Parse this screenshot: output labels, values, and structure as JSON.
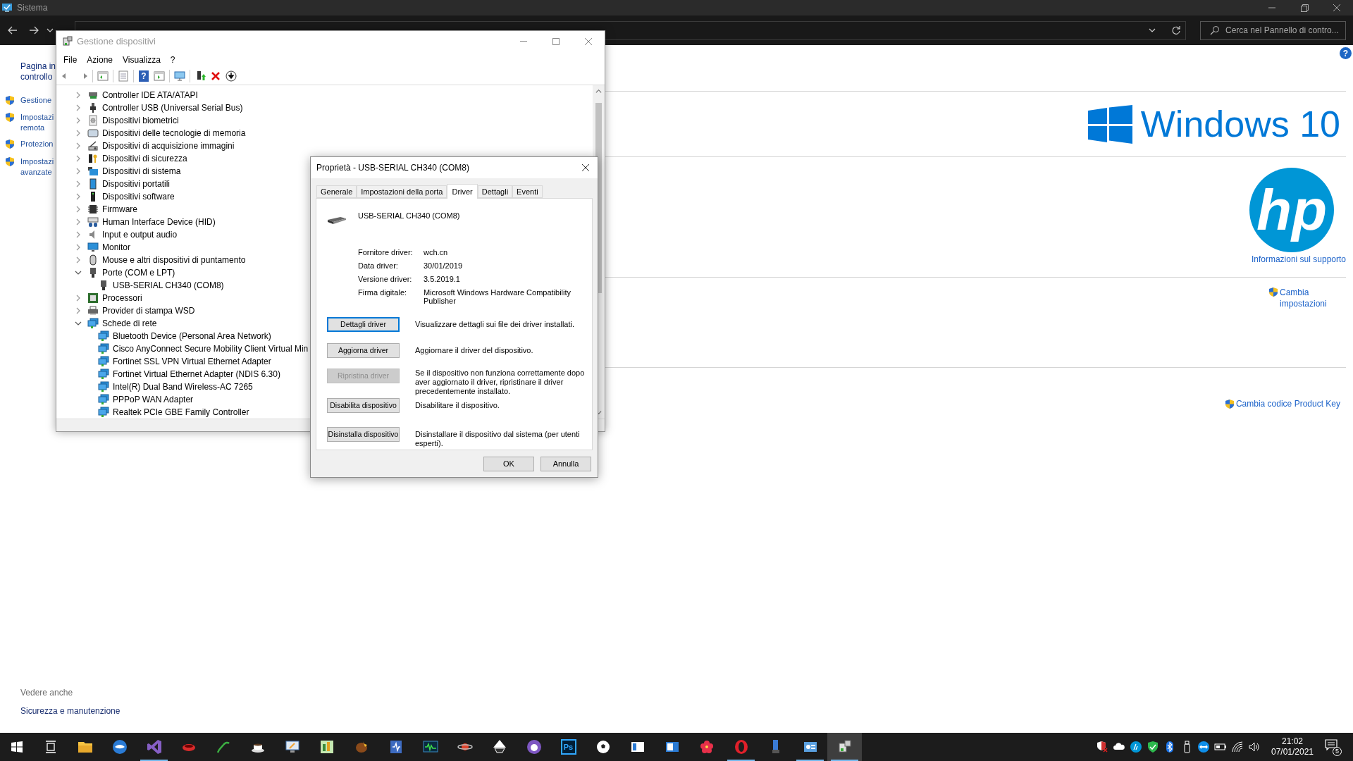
{
  "window": {
    "title": "Sistema",
    "search": {
      "placeholder": "Cerca nel Pannello di contro..."
    },
    "help": "?"
  },
  "sidebar": {
    "items": [
      {
        "kind": "home",
        "lines": [
          "Pagina in",
          "controllo"
        ]
      },
      {
        "kind": "admin",
        "lines": [
          "Gestione"
        ]
      },
      {
        "kind": "admin",
        "lines": [
          "Impostazi",
          "remota"
        ]
      },
      {
        "kind": "admin",
        "lines": [
          "Protezion"
        ]
      },
      {
        "kind": "admin",
        "lines": [
          "Impostazi",
          "avanzate"
        ]
      }
    ],
    "see_also": {
      "heading": "Vedere anche",
      "links": [
        "Sicurezza e manutenzione"
      ]
    }
  },
  "windows_logo": {
    "text": "Windows 10"
  },
  "manufacturer": {
    "logo": "hp",
    "support_link": "Informazioni sul supporto"
  },
  "settings_link": "Cambia impostazioni",
  "product_key_link": "Cambia codice Product Key",
  "device_manager": {
    "title": "Gestione dispositivi",
    "menu": [
      "File",
      "Azione",
      "Visualizza",
      "?"
    ],
    "toolbar_help": "?",
    "tree": [
      {
        "label": "Controller IDE ATA/ATAPI",
        "expanded": false
      },
      {
        "label": "Controller USB (Universal Serial Bus)",
        "expanded": false
      },
      {
        "label": "Dispositivi biometrici",
        "expanded": false
      },
      {
        "label": "Dispositivi delle tecnologie di memoria",
        "expanded": false
      },
      {
        "label": "Dispositivi di acquisizione immagini",
        "expanded": false
      },
      {
        "label": "Dispositivi di sicurezza",
        "expanded": false
      },
      {
        "label": "Dispositivi di sistema",
        "expanded": false
      },
      {
        "label": "Dispositivi portatili",
        "expanded": false
      },
      {
        "label": "Dispositivi software",
        "expanded": false
      },
      {
        "label": "Firmware",
        "expanded": false
      },
      {
        "label": "Human Interface Device (HID)",
        "expanded": false
      },
      {
        "label": "Input e output audio",
        "expanded": false
      },
      {
        "label": "Monitor",
        "expanded": false
      },
      {
        "label": "Mouse e altri dispositivi di puntamento",
        "expanded": false
      },
      {
        "label": "Porte (COM e LPT)",
        "expanded": true,
        "children": [
          {
            "label": "USB-SERIAL CH340 (COM8)"
          }
        ]
      },
      {
        "label": "Processori",
        "expanded": false
      },
      {
        "label": "Provider di stampa WSD",
        "expanded": false
      },
      {
        "label": "Schede di rete",
        "expanded": true,
        "children": [
          {
            "label": "Bluetooth Device (Personal Area Network)"
          },
          {
            "label": "Cisco AnyConnect Secure Mobility Client Virtual Min"
          },
          {
            "label": "Fortinet SSL VPN Virtual Ethernet Adapter"
          },
          {
            "label": "Fortinet Virtual Ethernet Adapter (NDIS 6.30)"
          },
          {
            "label": "Intel(R) Dual Band Wireless-AC 7265"
          },
          {
            "label": "PPPoP WAN Adapter"
          },
          {
            "label": "Realtek PCIe GBE Family Controller"
          }
        ]
      }
    ]
  },
  "properties": {
    "title": "Proprietà - USB-SERIAL CH340 (COM8)",
    "tabs": [
      {
        "label": "Generale",
        "selected": false
      },
      {
        "label": "Impostazioni della porta",
        "selected": false
      },
      {
        "label": "Driver",
        "selected": true
      },
      {
        "label": "Dettagli",
        "selected": false
      },
      {
        "label": "Eventi",
        "selected": false
      }
    ],
    "device_name": "USB-SERIAL CH340 (COM8)",
    "fields": [
      {
        "label": "Fornitore driver:",
        "value": "wch.cn"
      },
      {
        "label": "Data driver:",
        "value": "30/01/2019"
      },
      {
        "label": "Versione driver:",
        "value": "3.5.2019.1"
      },
      {
        "label": "Firma digitale:",
        "value": "Microsoft Windows Hardware Compatibility Publisher"
      }
    ],
    "actions": [
      {
        "label": "Dettagli driver",
        "description": "Visualizzare dettagli sui file dei driver installati.",
        "disabled": false,
        "focused": true
      },
      {
        "label": "Aggiorna driver",
        "description": "Aggiornare il driver del dispositivo.",
        "disabled": false,
        "focused": false
      },
      {
        "label": "Ripristina driver",
        "description": "Se il dispositivo non funziona correttamente dopo aver aggiornato il driver, ripristinare il driver precedentemente installato.",
        "disabled": true,
        "focused": false
      },
      {
        "label": "Disabilita dispositivo",
        "description": "Disabilitare il dispositivo.",
        "disabled": false,
        "focused": false
      },
      {
        "label": "Disinstalla dispositivo",
        "description": "Disinstallare il dispositivo dal sistema (per utenti esperti).",
        "disabled": false,
        "focused": false
      }
    ],
    "buttons": [
      "OK",
      "Annulla"
    ]
  },
  "taskbar": {
    "apps": [
      {
        "running": false,
        "selected": false
      },
      {
        "running": false,
        "selected": false
      },
      {
        "running": true,
        "selected": false
      },
      {
        "running": false,
        "selected": false
      },
      {
        "running": false,
        "selected": false
      },
      {
        "running": false,
        "selected": false
      },
      {
        "running": false,
        "selected": false
      },
      {
        "running": false,
        "selected": false
      },
      {
        "running": false,
        "selected": false
      },
      {
        "running": false,
        "selected": false
      },
      {
        "running": false,
        "selected": false
      },
      {
        "running": false,
        "selected": false
      },
      {
        "running": false,
        "selected": false
      },
      {
        "running": false,
        "selected": false
      },
      {
        "label": "Ps",
        "running": false,
        "selected": false
      },
      {
        "running": false,
        "selected": false
      },
      {
        "running": false,
        "selected": false
      },
      {
        "running": false,
        "selected": false
      },
      {
        "running": false,
        "selected": false
      },
      {
        "running": true,
        "selected": false
      },
      {
        "running": false,
        "selected": false
      },
      {
        "running": true,
        "selected": false
      },
      {
        "running": true,
        "selected": true
      }
    ],
    "clock": {
      "time": "21:02",
      "date": "07/01/2021"
    },
    "notifications": "5"
  }
}
